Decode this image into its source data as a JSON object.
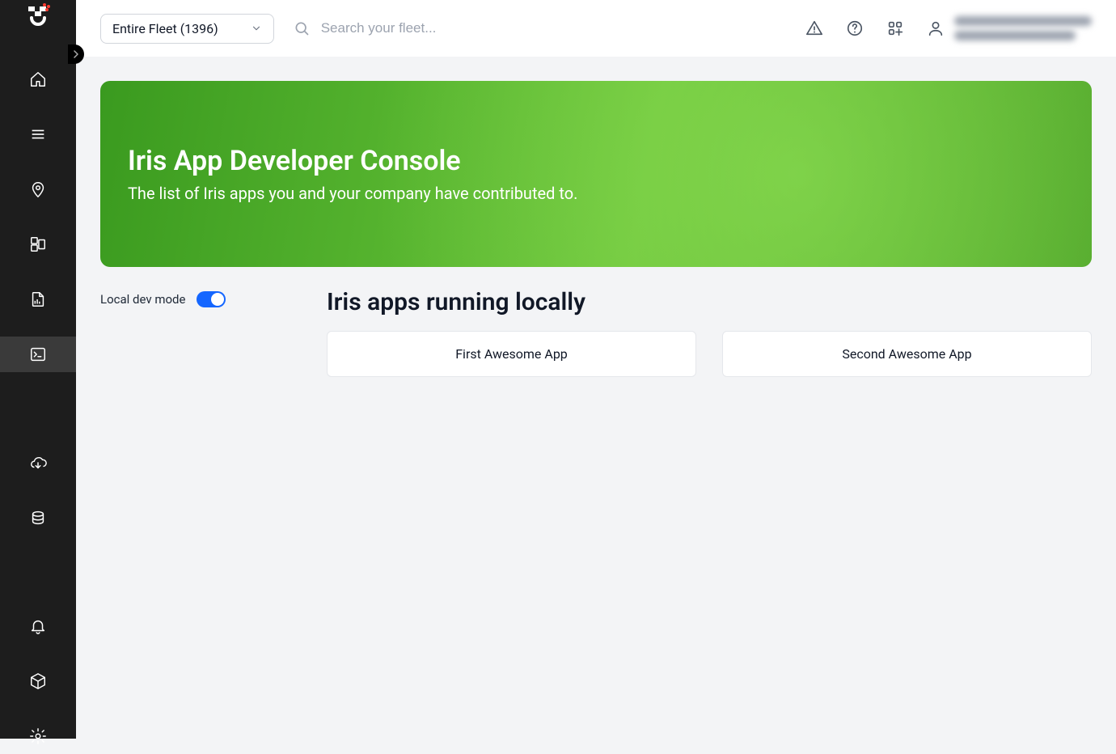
{
  "sidebar": {
    "nav": {
      "home": "home-icon",
      "menu": "menu-icon",
      "location": "location-icon",
      "grid": "widgets-icon",
      "report": "report-icon",
      "console": "terminal-icon",
      "download": "cloud-download-icon",
      "cake": "data-icon",
      "bell": "bell-icon",
      "cube": "cube-icon",
      "gear": "gear-icon"
    }
  },
  "topbar": {
    "fleet_label": "Entire Fleet (1396)",
    "search_placeholder": "Search your fleet..."
  },
  "hero": {
    "title": "Iris App Developer Console",
    "subtitle": "The list of Iris apps you and your company have contributed to."
  },
  "dev_mode": {
    "label": "Local dev mode",
    "enabled": true
  },
  "section": {
    "title": "Iris apps running locally",
    "cards": [
      {
        "name": "First Awesome App"
      },
      {
        "name": "Second Awesome App"
      }
    ]
  }
}
